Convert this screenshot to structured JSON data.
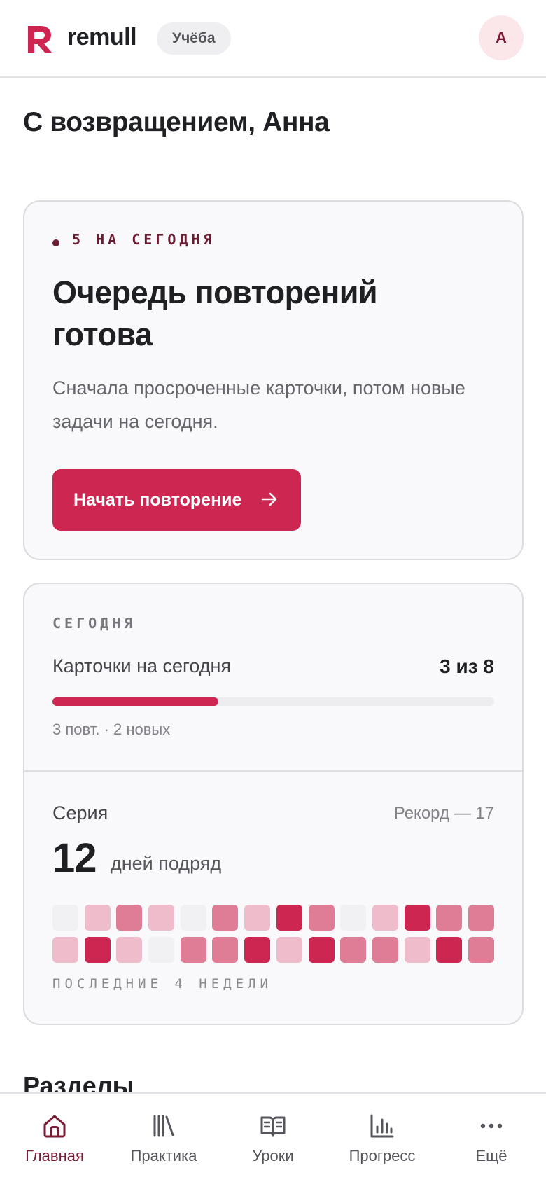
{
  "header": {
    "brand": "remull",
    "context": "Учёба",
    "avatar_initial": "A",
    "brand_color": "#cc2651"
  },
  "greeting": "С возвращением, Анна",
  "queue": {
    "eyebrow": "5 НА СЕГОДНЯ",
    "title": "Очередь повторений готова",
    "description": "Сначала просроченные карточки, потом новые задачи на сегодня.",
    "button_label": "Начать повторение",
    "button_icon": "arrow-right-icon"
  },
  "today": {
    "eyebrow": "СЕГОДНЯ",
    "label": "Карточки на сегодня",
    "count": "3 из 8",
    "progress": 0.375,
    "subtext": "3 повт. · 2 новых"
  },
  "streak": {
    "label": "Серия",
    "record": "Рекорд — 17",
    "days": "12",
    "unit": "дней подряд",
    "caption": "ПОСЛЕДНИЕ 4 НЕДЕЛИ",
    "heatmap_levels": [
      [
        0,
        1,
        2,
        1,
        0,
        2,
        1,
        3,
        2,
        0,
        1,
        3,
        2,
        2
      ],
      [
        1,
        3,
        1,
        0,
        2,
        2,
        3,
        1,
        3,
        2,
        2,
        1,
        3,
        2
      ]
    ]
  },
  "sections": {
    "title": "Разделы"
  },
  "nav": {
    "items": [
      {
        "label": "Главная",
        "icon": "home-icon",
        "active": true
      },
      {
        "label": "Практика",
        "icon": "library-icon",
        "active": false
      },
      {
        "label": "Уроки",
        "icon": "book-icon",
        "active": false
      },
      {
        "label": "Прогресс",
        "icon": "chart-icon",
        "active": false
      },
      {
        "label": "Ещё",
        "icon": "more-icon",
        "active": false
      }
    ]
  }
}
